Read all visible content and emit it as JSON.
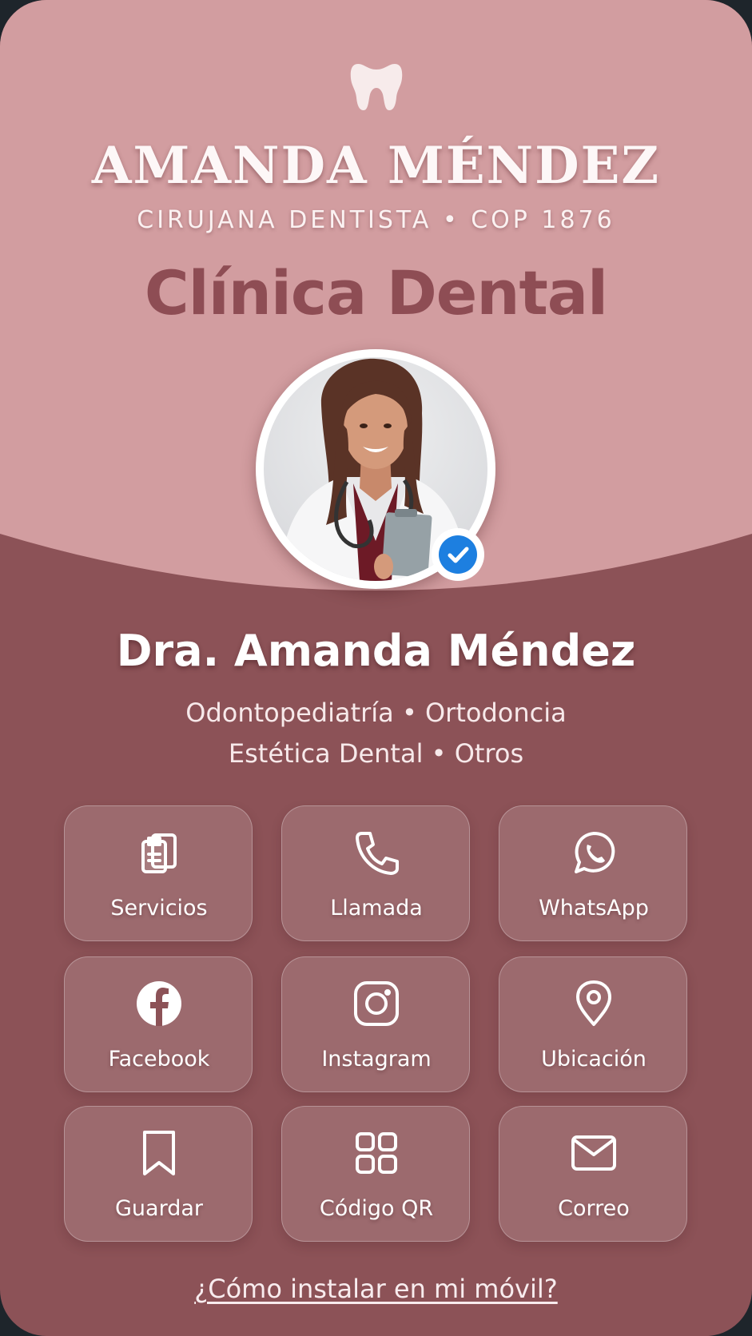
{
  "header": {
    "logo_icon": "tooth-icon",
    "name": "AMANDA MÉNDEZ",
    "subtitle": "CIRUJANA DENTISTA • COP 1876",
    "clinic": "Clínica Dental"
  },
  "profile": {
    "photo": "doctor-portrait",
    "verified_icon": "verified-check-icon",
    "name": "Dra. Amanda Méndez",
    "specialties_line1": "Odontopediatría • Ortodoncia",
    "specialties_line2": "Estética Dental • Otros"
  },
  "actions": [
    {
      "label": "Servicios",
      "icon": "clipboard-icon"
    },
    {
      "label": "Llamada",
      "icon": "phone-icon"
    },
    {
      "label": "WhatsApp",
      "icon": "whatsapp-icon"
    },
    {
      "label": "Facebook",
      "icon": "facebook-icon"
    },
    {
      "label": "Instagram",
      "icon": "instagram-icon"
    },
    {
      "label": "Ubicación",
      "icon": "location-pin-icon"
    },
    {
      "label": "Guardar",
      "icon": "bookmark-icon"
    },
    {
      "label": "Código QR",
      "icon": "qr-code-icon"
    },
    {
      "label": "Correo",
      "icon": "mail-icon"
    }
  ],
  "footer": {
    "install_link": "¿Cómo instalar en mi móvil?"
  },
  "colors": {
    "top_background": "#d29da0",
    "bottom_background": "#8c5257",
    "clinic_text": "#8e4d54",
    "verified_badge": "#1d7fe0"
  }
}
